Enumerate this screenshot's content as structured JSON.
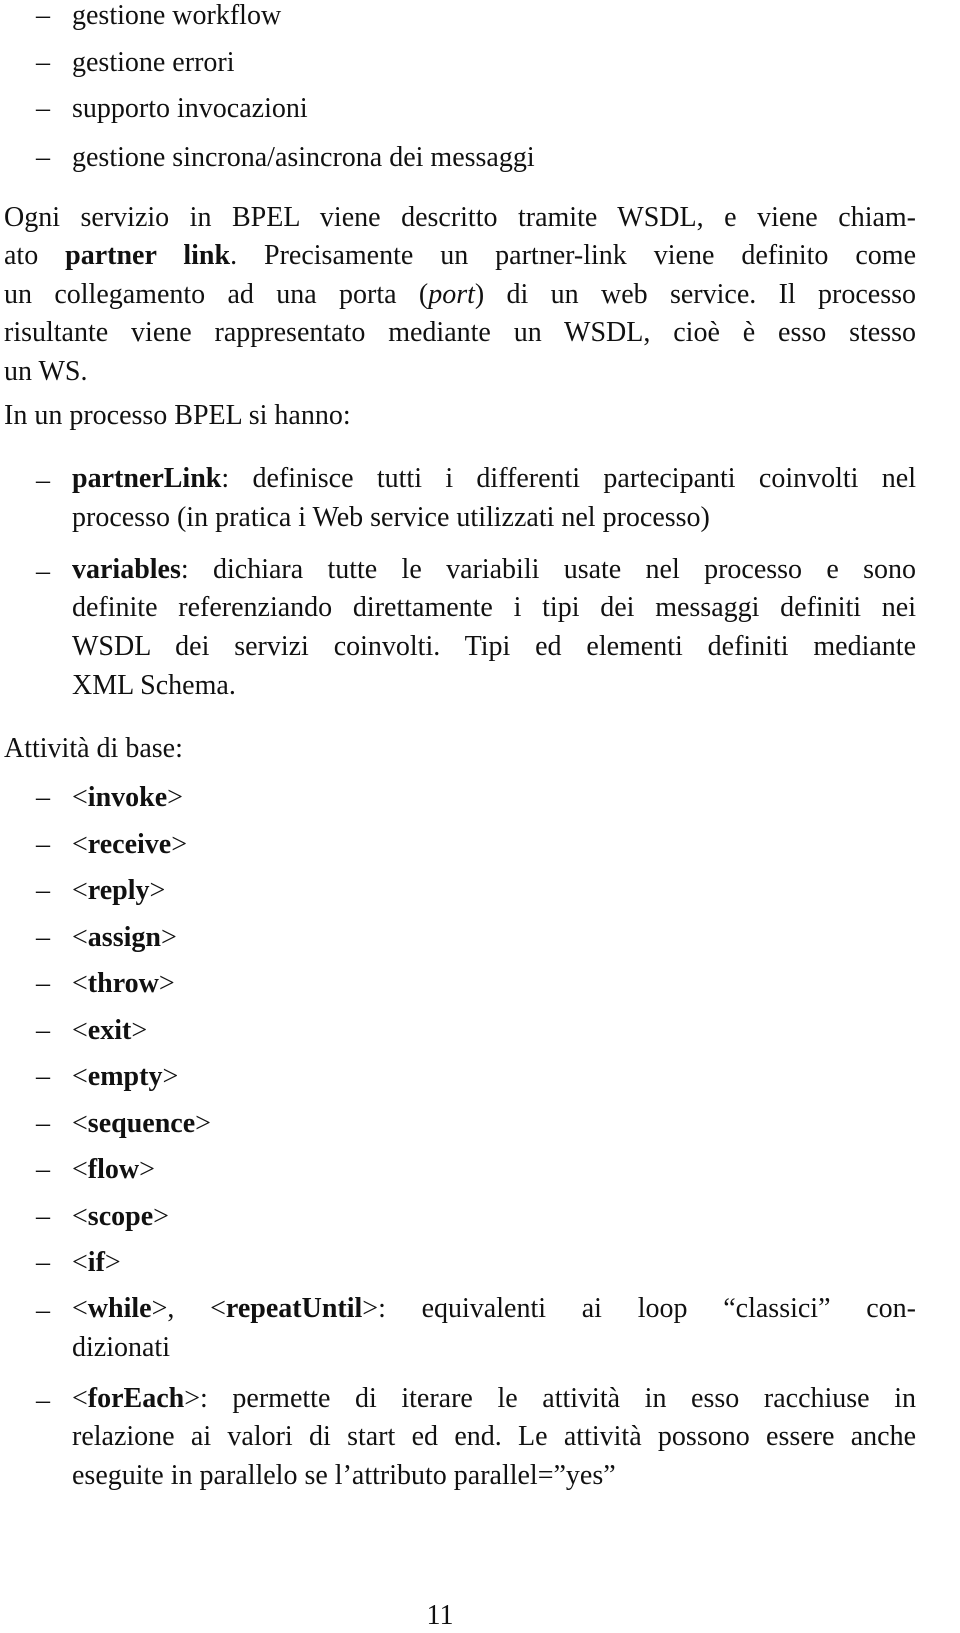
{
  "intro_list": [
    "gestione workflow",
    "gestione errori",
    "supporto invocazioni",
    "gestione sincrona/asincrona dei messaggi"
  ],
  "paragraph1": {
    "line1": "Ogni servizio in BPEL viene descritto tramite WSDL, e viene chiam-",
    "line2_pre": "ato ",
    "line2_bold": "partner link",
    "line2_post": ".  Precisamente un partner-link viene definito come",
    "line3_pre": "un collegamento ad una porta (",
    "line3_italic": "port",
    "line3_post": ") di un web service.  Il processo",
    "line4": "risultante viene rappresentato mediante un WSDL, cioè è esso stesso",
    "line5": "un WS."
  },
  "paragraph2": "In un processo BPEL si hanno:",
  "components": [
    {
      "term": "partnerLink",
      "lines": [
        ": definisce tutti i differenti partecipanti coinvolti nel",
        "processo (in pratica i Web service utilizzati nel processo)"
      ]
    },
    {
      "term": "variables",
      "lines": [
        ":  dichiara tutte le variabili usate nel processo e sono",
        "definite referenziando direttamente i tipi dei messaggi definiti nei",
        "WSDL dei servizi coinvolti.  Tipi ed elementi definiti mediante",
        "XML Schema."
      ]
    }
  ],
  "activities_heading": "Attività di base:",
  "activities": [
    "invoke",
    "receive",
    "reply",
    "assign",
    "throw",
    "exit",
    "empty",
    "sequence",
    "flow",
    "scope",
    "if"
  ],
  "loop_item": {
    "tag1": "while",
    "tag2": "repeatUntil",
    "line1_rest": ":  equivalenti ai loop “classici” con-",
    "line2": "dizionati"
  },
  "foreach_item": {
    "tag": "forEach",
    "line1_rest": ":  permette di iterare le attività in esso racchiuse in",
    "line2": "relazione ai valori di start ed end.  Le attività possono essere anche",
    "line3": "eseguite in parallelo se l’attributo parallel=”yes”"
  },
  "dash": "–",
  "lt": "<",
  "gt": ">",
  "page_number": "11"
}
